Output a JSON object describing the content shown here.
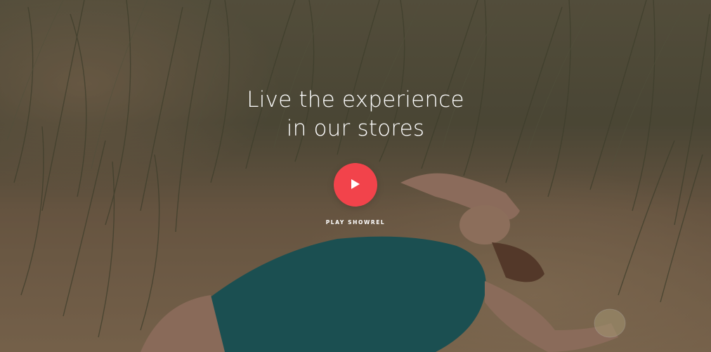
{
  "hero": {
    "headline_line1": "Live the experience",
    "headline_line2": "in our stores",
    "play_label": "PLAY SHOWREL",
    "play_icon": "play-icon",
    "accent_color": "#f2434b"
  }
}
